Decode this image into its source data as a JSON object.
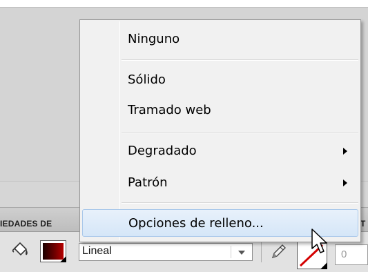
{
  "panel": {
    "title": "IEDADES DE",
    "title_right": "T"
  },
  "toolbar": {
    "fill_type_value": "Lineal",
    "stroke_width_value": "0",
    "fill_color": "#8b0000",
    "stroke_color": "#d40000"
  },
  "menu": {
    "items": [
      {
        "label": "Ninguno"
      },
      {
        "label": "Sólido"
      },
      {
        "label": "Tramado web"
      },
      {
        "label": "Degradado",
        "submenu": true
      },
      {
        "label": "Patrón",
        "submenu": true
      },
      {
        "label": "Opciones de relleno...",
        "highlighted": true
      }
    ]
  },
  "icons": {
    "bucket": "paint-bucket-icon",
    "pencil": "pencil-icon",
    "cursor": "mouse-pointer-icon"
  }
}
